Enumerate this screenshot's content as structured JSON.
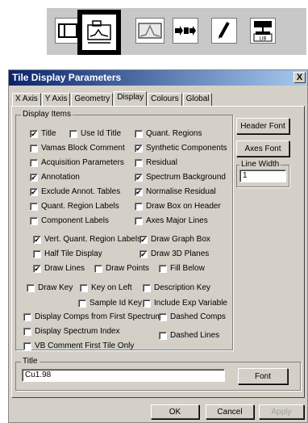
{
  "toolbar": {
    "buttons": [
      {
        "icon": "split-view-icon"
      },
      {
        "icon": "tile-display-icon"
      },
      {
        "icon": "spectrum-peak-icon"
      },
      {
        "icon": "forward-arrow-icon"
      },
      {
        "icon": "pencil-icon"
      },
      {
        "icon": "library-icon",
        "label": "LIB"
      }
    ]
  },
  "dialog": {
    "title": "Tile Display Parameters",
    "close": "X",
    "tabs": [
      "X Axis",
      "Y Axis",
      "Geometry",
      "Display",
      "Colours",
      "Global"
    ],
    "active_tab": "Display",
    "display_items_label": "Display Items",
    "checkboxes": [
      {
        "label": "Title",
        "checked": true
      },
      {
        "label": "Use Id Title",
        "checked": false
      },
      {
        "label": "Quant. Regions",
        "checked": false
      },
      {
        "label": "Vamas Block Comment",
        "checked": false
      },
      {
        "label": "Synthetic Components",
        "checked": true
      },
      {
        "label": "Acquisition Parameters",
        "checked": false
      },
      {
        "label": "Residual",
        "checked": false
      },
      {
        "label": "Annotation",
        "checked": true
      },
      {
        "label": "Spectrum Background",
        "checked": true
      },
      {
        "label": "Exclude Annot. Tables",
        "checked": true
      },
      {
        "label": "Normalise Residual",
        "checked": true
      },
      {
        "label": "Quant. Region Labels",
        "checked": false
      },
      {
        "label": "Draw Box on Header",
        "checked": false
      },
      {
        "label": "Component Labels",
        "checked": false
      },
      {
        "label": "Axes Major Lines",
        "checked": false
      },
      {
        "label": "Vert. Quant. Region Labels",
        "checked": true
      },
      {
        "label": "Draw Graph Box",
        "checked": true
      },
      {
        "label": "Half Tile Display",
        "checked": false
      },
      {
        "label": "Draw 3D Planes",
        "checked": true
      },
      {
        "label": "Draw Lines",
        "checked": true
      },
      {
        "label": "Draw Points",
        "checked": false
      },
      {
        "label": "Fill Below",
        "checked": false
      },
      {
        "label": "Draw Key",
        "checked": false
      },
      {
        "label": "Key on Left",
        "checked": false
      },
      {
        "label": "Description Key",
        "checked": false
      },
      {
        "label": "Sample Id Key",
        "checked": false
      },
      {
        "label": "Include Exp Variable",
        "checked": false
      },
      {
        "label": "Display Comps from First Spectrum",
        "checked": false
      },
      {
        "label": "Dashed Comps",
        "checked": false
      },
      {
        "label": "Display Spectrum Index",
        "checked": false
      },
      {
        "label": "Dashed Lines",
        "checked": false
      },
      {
        "label": "VB Comment First Tile Only",
        "checked": false
      }
    ],
    "header_font_button": "Header Font",
    "axes_font_button": "Axes Font",
    "line_width_label": "Line Width",
    "line_width_value": "1",
    "title_group_label": "Title",
    "title_value": "Cu1.98",
    "title_font_button": "Font",
    "ok": "OK",
    "cancel": "Cancel",
    "apply": "Apply"
  }
}
